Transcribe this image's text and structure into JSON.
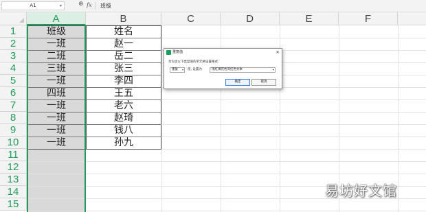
{
  "formula_bar": {
    "name_box": "A1",
    "zoom_icon": "magnify-icon",
    "fx_label": "fx",
    "content": "班级"
  },
  "columns": [
    "A",
    "B",
    "C",
    "D",
    "E",
    "F"
  ],
  "rows": [
    "1",
    "2",
    "3",
    "4",
    "5",
    "6",
    "7",
    "8",
    "9",
    "10",
    "11",
    "12",
    "13",
    "14",
    "15"
  ],
  "table": {
    "col_a": [
      "班级",
      "一班",
      "二班",
      "三班",
      "一班",
      "四班",
      "一班",
      "一班",
      "一班",
      "一班"
    ],
    "col_b": [
      "姓名",
      "赵一",
      "岳二",
      "张三",
      "李四",
      "王五",
      "老六",
      "赵琦",
      "钱八",
      "孙九"
    ]
  },
  "dialog": {
    "title": "重复值",
    "close": "×",
    "description": "为包含以下类型值的单元格设置格式:",
    "type_select": "重复",
    "middle_text": "值, 设置为",
    "format_select": "浅红填充色深红色文本",
    "ok": "确定",
    "cancel": "取消"
  },
  "watermark": "易坊好文馆",
  "colors": {
    "accent": "#1f9c5a",
    "selected_column_fill": "#d9d9d9"
  }
}
